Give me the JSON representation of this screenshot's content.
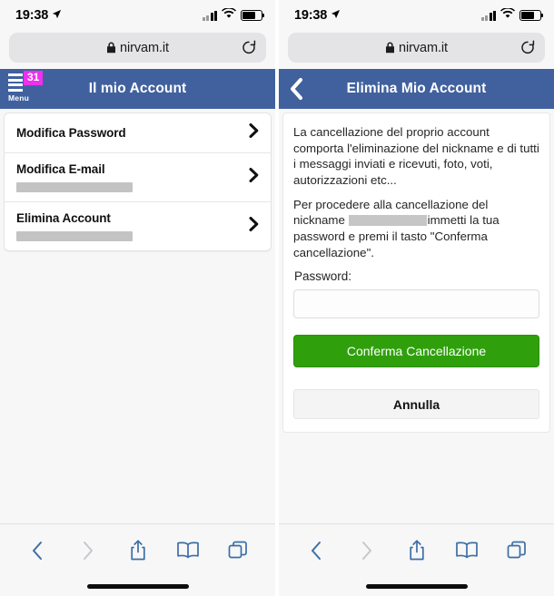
{
  "statusbar": {
    "time": "19:38",
    "location_icon": "location-arrow-icon",
    "signal_icon": "cellular-signal-icon",
    "wifi_icon": "wifi-icon",
    "battery_icon": "battery-icon"
  },
  "browser": {
    "url": "nirvam.it",
    "lock_icon": "lock-icon",
    "reload_icon": "reload-icon"
  },
  "toolbar": {
    "back_icon": "back-chevron-icon",
    "forward_icon": "forward-chevron-icon",
    "share_icon": "share-icon",
    "bookmarks_icon": "book-icon",
    "tabs_icon": "tabs-icon"
  },
  "left_screen": {
    "header": {
      "title": "Il mio Account",
      "menu_label": "Menu",
      "menu_badge": "31",
      "menu_icon": "hamburger-menu-icon",
      "badge_color": "#ef2fef",
      "bar_color": "#41619e"
    },
    "list": [
      {
        "label": "Modifica Password",
        "redacted": false,
        "chevron_icon": "chevron-right-icon"
      },
      {
        "label": "Modifica E-mail",
        "redacted": true,
        "chevron_icon": "chevron-right-icon"
      },
      {
        "label": "Elimina Account",
        "redacted": true,
        "chevron_icon": "chevron-right-icon"
      }
    ]
  },
  "right_screen": {
    "header": {
      "title": "Elimina Mio Account",
      "back_icon": "back-arrow-icon",
      "bar_color": "#41619e"
    },
    "paragraph_1": "La cancellazione del proprio account comporta l'eliminazione del nickname e di tutti i messaggi inviati e ricevuti, foto, voti, autorizzazioni etc...",
    "paragraph_2_before": "Per procedere alla cancellazione del nickname",
    "paragraph_2_after": "immetti la tua password e premi il tasto \"Conferma cancellazione\".",
    "password_label": "Password:",
    "password_value": "",
    "password_placeholder": "",
    "confirm_button": "Conferma Cancellazione",
    "confirm_color": "#2fa00c",
    "cancel_button": "Annulla"
  }
}
